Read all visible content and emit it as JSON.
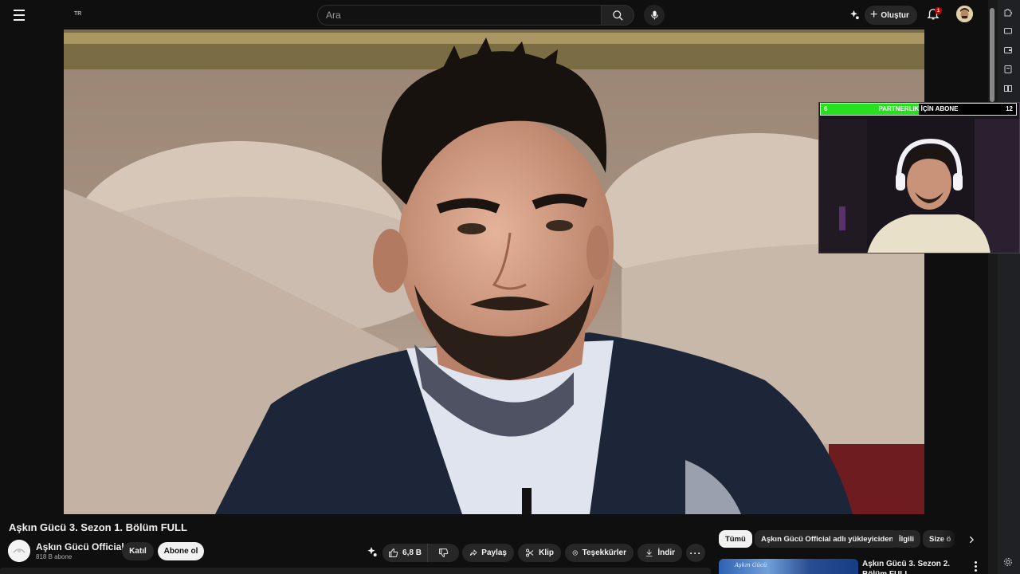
{
  "topbar": {
    "region": "TR",
    "search_placeholder": "Ara",
    "create_label": "Oluştur",
    "notification_count": "1"
  },
  "overlay": {
    "goal_current": "6",
    "goal_label": "PARTNERLIK İÇİN ABONE",
    "goal_target": "12",
    "goal_progress": 0.5
  },
  "video": {
    "title": "Aşkın Gücü 3. Sezon 1. Bölüm FULL"
  },
  "channel": {
    "name": "Aşkın Gücü Official",
    "subscribers": "818 B abone",
    "join_label": "Katıl",
    "subscribe_label": "Abone ol"
  },
  "actions": {
    "likes": "6,8 B",
    "share": "Paylaş",
    "clip": "Klip",
    "thanks": "Teşekkürler",
    "download": "İndir"
  },
  "chips": [
    {
      "label": "Tümü"
    },
    {
      "label": "Aşkın Gücü Official adlı yükleyiciden"
    },
    {
      "label": "İlgili"
    },
    {
      "label": "Size ö"
    }
  ],
  "recommendation": {
    "title": "Aşkın Gücü 3. Sezon 2. Bölüm FULL",
    "thumb_text": "Aşkın Gücü"
  },
  "colors": {
    "background": "#0f0f0f",
    "goal_fill": "#27e01f",
    "badge": "#cc0000"
  }
}
